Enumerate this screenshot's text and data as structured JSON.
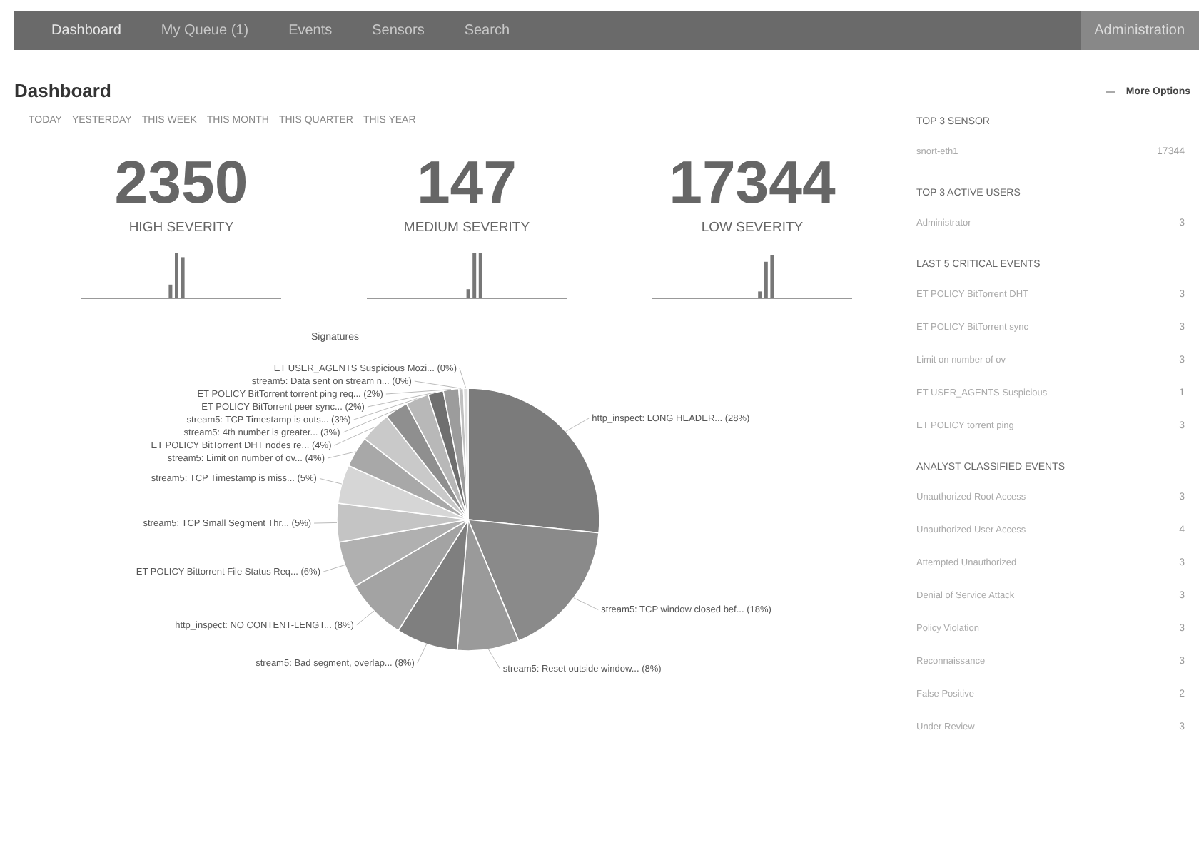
{
  "nav": {
    "items": [
      {
        "label": "Dashboard",
        "selected": true
      },
      {
        "label": "My Queue (1)",
        "selected": false
      },
      {
        "label": "Events",
        "selected": false
      },
      {
        "label": "Sensors",
        "selected": false
      },
      {
        "label": "Search",
        "selected": false
      }
    ],
    "right": "Administration"
  },
  "page": {
    "title": "Dashboard",
    "more_options": "More Options"
  },
  "ranges": [
    {
      "label": "TODAY",
      "selected": false
    },
    {
      "label": "YESTERDAY",
      "selected": false
    },
    {
      "label": "THIS WEEK",
      "selected": false
    },
    {
      "label": "THIS MONTH",
      "selected": false
    },
    {
      "label": "THIS QUARTER",
      "selected": false
    },
    {
      "label": "THIS YEAR",
      "selected": false
    }
  ],
  "severities": [
    {
      "count": "2350",
      "label": "HIGH SEVERITY"
    },
    {
      "count": "147",
      "label": "MEDIUM SEVERITY"
    },
    {
      "count": "17344",
      "label": "LOW SEVERITY"
    }
  ],
  "signatures": {
    "title": "Signatures",
    "chart_data": {
      "type": "pie",
      "categories": [
        "http_inspect: LONG HEADER... (28%)",
        "stream5: TCP window closed bef... (18%)",
        "stream5: Reset outside window... (8%)",
        "stream5: Bad segment, overlap... (8%)",
        "http_inspect: NO CONTENT-LENGT... (8%)",
        "ET POLICY Bittorrent File Status Req... (6%)",
        "stream5: TCP Small Segment Thr... (5%)",
        "stream5: TCP Timestamp is miss... (5%)",
        "stream5: Limit on number of ov... (4%)",
        "ET POLICY BitTorrent DHT nodes re... (4%)",
        "stream5: 4th number is greater... (3%)",
        "stream5: TCP Timestamp is outs... (3%)",
        "ET POLICY BitTorrent peer sync... (2%)",
        "ET POLICY BitTorrent torrent ping req... (2%)",
        "stream5: Data sent on stream n... (0%)",
        "ET USER_AGENTS Suspicious Mozi... (0%)"
      ],
      "values": [
        28,
        18,
        8,
        8,
        8,
        6,
        5,
        5,
        4,
        4,
        3,
        3,
        2,
        2,
        0.6,
        0.6
      ]
    }
  },
  "sidebar": [
    {
      "title": "TOP 3 SENSOR",
      "items": [
        {
          "name": "snort-eth1",
          "count": "17344"
        }
      ]
    },
    {
      "title": "TOP 3 ACTIVE USERS",
      "items": [
        {
          "name": "Administrator",
          "count": "3"
        }
      ]
    },
    {
      "title": "LAST 5 CRITICAL EVENTS",
      "items": [
        {
          "name": "ET POLICY BitTorrent DHT",
          "count": "3"
        },
        {
          "name": "ET POLICY BitTorrent sync",
          "count": "3"
        },
        {
          "name": "Limit on number of ov",
          "count": "3"
        },
        {
          "name": "ET USER_AGENTS Suspicious",
          "count": "1"
        },
        {
          "name": "ET POLICY torrent ping",
          "count": "3"
        }
      ]
    },
    {
      "title": "ANALYST CLASSIFIED EVENTS",
      "items": [
        {
          "name": "Unauthorized Root Access",
          "count": "3"
        },
        {
          "name": "Unauthorized User Access",
          "count": "4"
        },
        {
          "name": "Attempted Unauthorized",
          "count": "3"
        },
        {
          "name": "Denial of Service Attack",
          "count": "3"
        },
        {
          "name": "Policy Violation",
          "count": "3"
        },
        {
          "name": "Reconnaissance",
          "count": "3"
        },
        {
          "name": "False Positive",
          "count": "2"
        },
        {
          "name": "Under Review",
          "count": "3"
        }
      ]
    }
  ]
}
